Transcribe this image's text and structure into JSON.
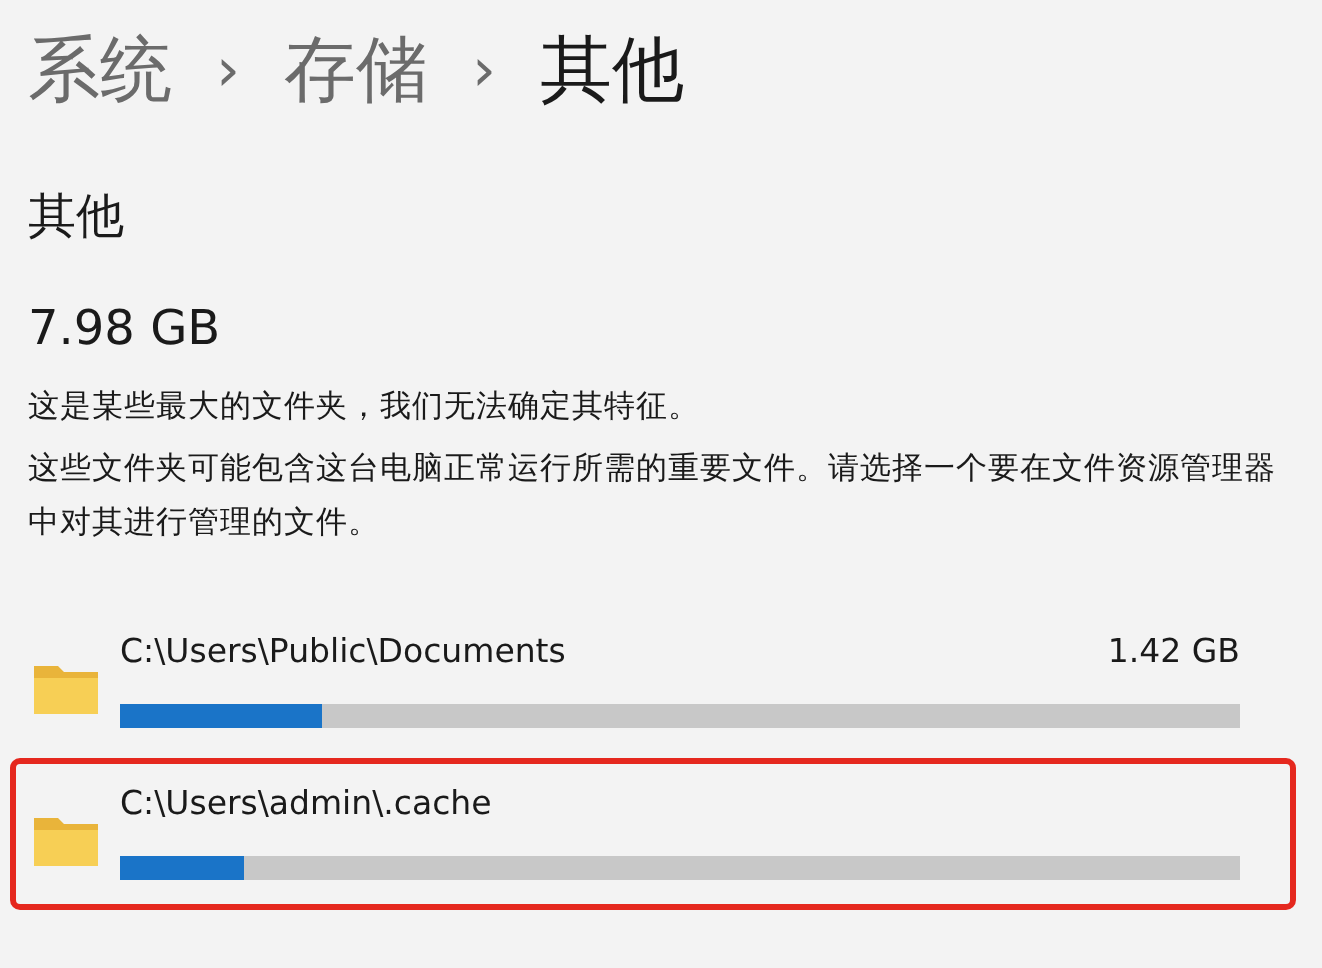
{
  "breadcrumb": [
    {
      "label": "系统",
      "current": false
    },
    {
      "label": "存储",
      "current": false
    },
    {
      "label": "其他",
      "current": true
    }
  ],
  "breadcrumb_separator": "›",
  "heading": "其他",
  "total": "7.98 GB",
  "description": [
    "这是某些最大的文件夹，我们无法确定其特征。",
    "这些文件夹可能包含这台电脑正常运行所需的重要文件。请选择一个要在文件资源管理器中对其进行管理的文件。"
  ],
  "folders": [
    {
      "path": "C:\\Users\\Public\\Documents",
      "size": "1.42 GB",
      "level": 0.18,
      "highlighted": false
    },
    {
      "path": "C:\\Users\\admin\\.cache",
      "level": 0.11,
      "highlighted": true
    }
  ]
}
